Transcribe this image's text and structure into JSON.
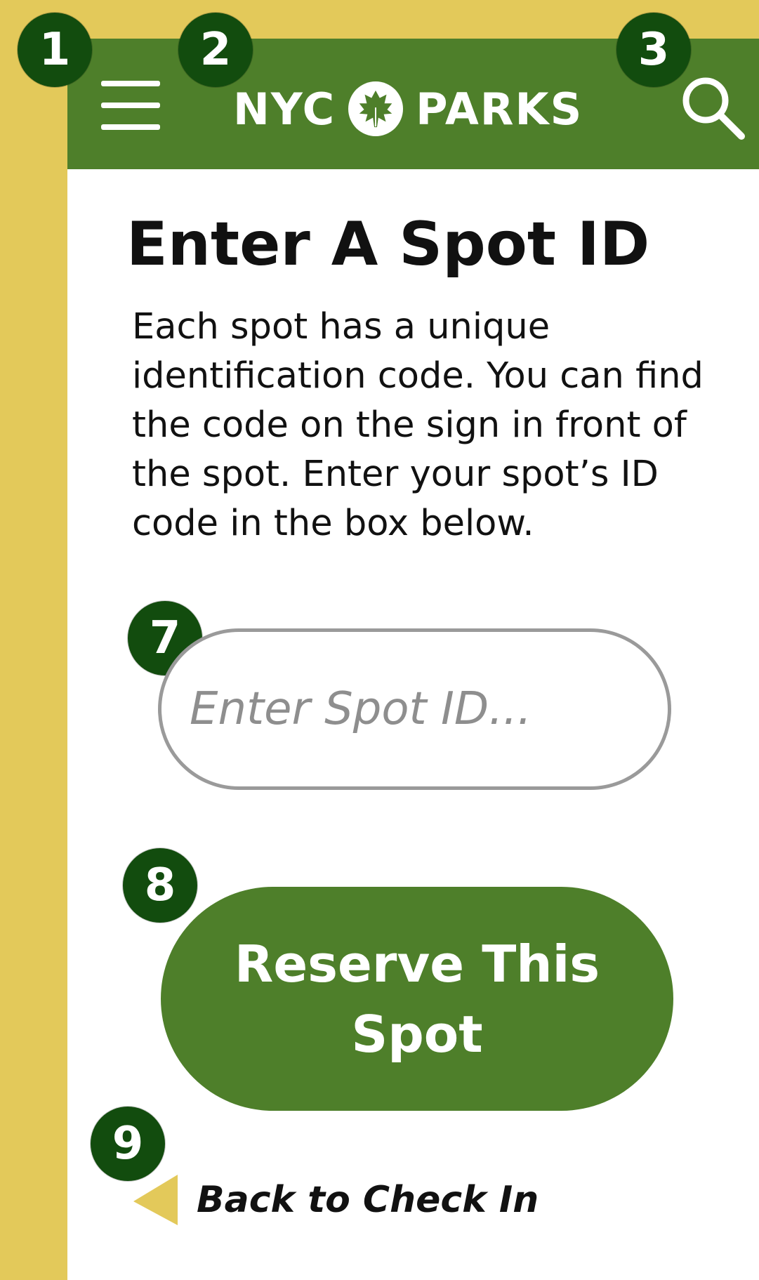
{
  "colors": {
    "background": "#E3C95A",
    "header_green": "#4E7F2A",
    "badge_green": "#124C0E",
    "page_white": "#FFFFFF",
    "input_border": "#9A9A9A",
    "back_arrow": "#E3C95A"
  },
  "header": {
    "brand_left": "NYC",
    "brand_right": "PARKS",
    "brand_icon": "maple-leaf-icon",
    "menu_icon": "menu-icon",
    "search_icon": "search-icon"
  },
  "badges": {
    "menu": "1",
    "logo": "2",
    "search": "3",
    "input": "7",
    "reserve": "8",
    "back": "9"
  },
  "main": {
    "title": "Enter A Spot ID",
    "description": "Each spot has a unique identification code. You can find the code on the sign in front of the spot. Enter your spot’s ID code in the box below.",
    "input_placeholder": "Enter Spot ID...",
    "input_value": "",
    "reserve_button_label": "Reserve This Spot",
    "back_link_label": "Back to Check In",
    "back_icon": "left-triangle-icon"
  }
}
